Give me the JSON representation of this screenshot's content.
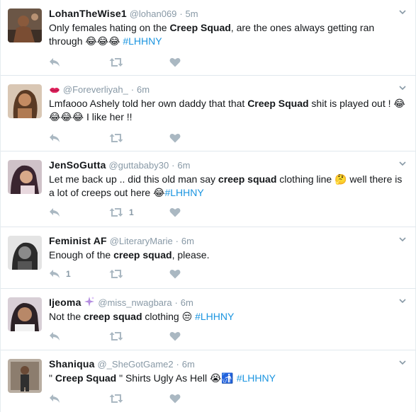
{
  "tweets": [
    {
      "name": "LohanTheWise1",
      "handle": "@lohan069",
      "separator": "·",
      "time": "5m",
      "segments": [
        {
          "t": "Only females hating on the ",
          "s": "plain"
        },
        {
          "t": "Creep Squad",
          "s": "bold"
        },
        {
          "t": ", are the ones always getting ran through ",
          "s": "plain"
        },
        {
          "t": "😂😂😂",
          "s": "emoji"
        },
        {
          "t": " ",
          "s": "plain"
        },
        {
          "t": "#LHHNY",
          "s": "hashtag"
        }
      ],
      "reply_count": "",
      "retweet_count": "",
      "like_count": ""
    },
    {
      "name": "",
      "handle": "@Foreverliyah_",
      "separator": "·",
      "time": "6m",
      "name_prefix_icon": "lips-icon",
      "segments": [
        {
          "t": "Lmfaooo Ashely told her own daddy that that ",
          "s": "plain"
        },
        {
          "t": "Creep Squad",
          "s": "bold"
        },
        {
          "t": " shit is played out ! ",
          "s": "plain"
        },
        {
          "t": "😂😂😂😂",
          "s": "emoji"
        },
        {
          "t": " I like her !!",
          "s": "plain"
        }
      ],
      "reply_count": "",
      "retweet_count": "",
      "like_count": ""
    },
    {
      "name": "JenSoGutta",
      "handle": "@guttababy30",
      "separator": "·",
      "time": "6m",
      "segments": [
        {
          "t": "Let me back up .. did this old man say ",
          "s": "plain"
        },
        {
          "t": "creep squad",
          "s": "bold"
        },
        {
          "t": " clothing line ",
          "s": "plain"
        },
        {
          "t": "🤔",
          "s": "emoji"
        },
        {
          "t": " well there is a lot of creeps out here ",
          "s": "plain"
        },
        {
          "t": "😂",
          "s": "emoji"
        },
        {
          "t": "#LHHNY",
          "s": "hashtag"
        }
      ],
      "reply_count": "",
      "retweet_count": "1",
      "like_count": ""
    },
    {
      "name": "Feminist AF",
      "handle": "@LiteraryMarie",
      "separator": "·",
      "time": "6m",
      "segments": [
        {
          "t": "Enough of the ",
          "s": "plain"
        },
        {
          "t": "creep squad",
          "s": "bold"
        },
        {
          "t": ", please.",
          "s": "plain"
        }
      ],
      "reply_count": "1",
      "retweet_count": "",
      "like_count": ""
    },
    {
      "name": "Ijeoma",
      "name_suffix_icon": "sparkles-icon",
      "handle": "@miss_nwagbara",
      "separator": "·",
      "time": "6m",
      "segments": [
        {
          "t": "Not the ",
          "s": "plain"
        },
        {
          "t": "creep squad",
          "s": "bold"
        },
        {
          "t": " clothing ",
          "s": "plain"
        },
        {
          "t": "😒",
          "s": "emoji"
        },
        {
          "t": " ",
          "s": "plain"
        },
        {
          "t": "#LHHNY",
          "s": "hashtag"
        }
      ],
      "reply_count": "",
      "retweet_count": "",
      "like_count": ""
    },
    {
      "name": "Shaniqua",
      "handle": "@_SheGotGame2",
      "separator": "·",
      "time": "6m",
      "segments": [
        {
          "t": "\" ",
          "s": "plain"
        },
        {
          "t": "Creep Squad",
          "s": "bold"
        },
        {
          "t": " \" Shirts Ugly As Hell ",
          "s": "plain"
        },
        {
          "t": "😭",
          "s": "emoji"
        },
        {
          "t": "🚮",
          "s": "emoji"
        },
        {
          "t": " ",
          "s": "plain"
        },
        {
          "t": "#LHHNY",
          "s": "hashtag"
        }
      ],
      "reply_count": "",
      "retweet_count": "",
      "like_count": ""
    }
  ],
  "colors": {
    "name": "#14171a",
    "meta": "#8899a6",
    "hashtag": "#1b95e0",
    "action_icon": "#aab8c2",
    "divider": "#e1e8ed"
  }
}
